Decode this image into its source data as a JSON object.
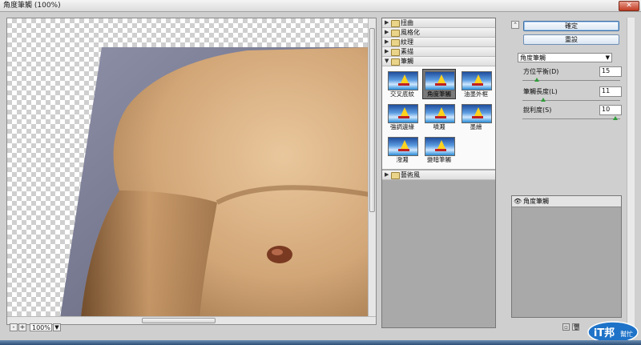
{
  "window": {
    "title": "角度筆觸 (100%)",
    "close_label": "✕"
  },
  "preview": {
    "zoom_value": "100%",
    "zoom_minus": "-",
    "zoom_plus": "+",
    "zoom_dropdown": "▼"
  },
  "gallery": {
    "categories_top": [
      {
        "label": "扭曲",
        "expanded": false
      },
      {
        "label": "風格化",
        "expanded": false
      },
      {
        "label": "紋理",
        "expanded": false
      },
      {
        "label": "素描",
        "expanded": false
      },
      {
        "label": "筆觸",
        "expanded": true
      }
    ],
    "filters": [
      {
        "label": "交叉底紋",
        "selected": false
      },
      {
        "label": "角度筆觸",
        "selected": true
      },
      {
        "label": "油墨外框",
        "selected": false
      },
      {
        "label": "強調邊緣",
        "selected": false
      },
      {
        "label": "噴濺",
        "selected": false
      },
      {
        "label": "墨繪",
        "selected": false
      },
      {
        "label": "潑濺",
        "selected": false
      },
      {
        "label": "變暗筆觸",
        "selected": false
      }
    ],
    "categories_bottom": [
      {
        "label": "藝術風",
        "expanded": false
      }
    ]
  },
  "controls": {
    "ok_label": "確定",
    "reset_label": "重設",
    "collapse_icon": "⌃",
    "filter_select": "角度筆觸",
    "params": [
      {
        "label": "方位平衡(D)",
        "value": "15",
        "level": 0.15
      },
      {
        "label": "筆觸長度(L)",
        "value": "11",
        "level": 0.22
      },
      {
        "label": "銳利度(S)",
        "value": "10",
        "level": 0.98
      }
    ]
  },
  "layers": {
    "items": [
      {
        "name": "角度筆觸",
        "visible": true
      }
    ]
  },
  "logo": {
    "text_main": "iT邦",
    "text_sub": "幫忙"
  },
  "colors": {
    "accent": "#3a6ea5",
    "panel_gray": "#a9a9a9",
    "slider_knob": "#2f9e3b"
  }
}
